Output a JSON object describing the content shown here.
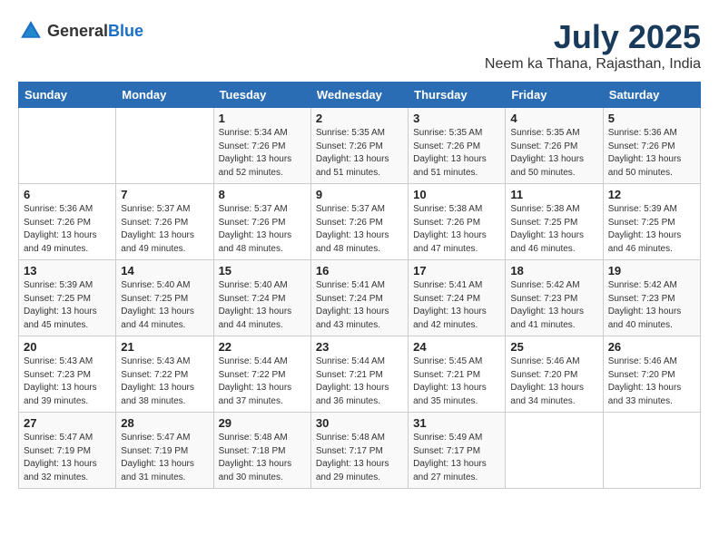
{
  "header": {
    "logo_general": "General",
    "logo_blue": "Blue",
    "title": "July 2025",
    "location": "Neem ka Thana, Rajasthan, India"
  },
  "weekdays": [
    "Sunday",
    "Monday",
    "Tuesday",
    "Wednesday",
    "Thursday",
    "Friday",
    "Saturday"
  ],
  "weeks": [
    [
      {
        "day": "",
        "detail": ""
      },
      {
        "day": "",
        "detail": ""
      },
      {
        "day": "1",
        "detail": "Sunrise: 5:34 AM\nSunset: 7:26 PM\nDaylight: 13 hours and 52 minutes."
      },
      {
        "day": "2",
        "detail": "Sunrise: 5:35 AM\nSunset: 7:26 PM\nDaylight: 13 hours and 51 minutes."
      },
      {
        "day": "3",
        "detail": "Sunrise: 5:35 AM\nSunset: 7:26 PM\nDaylight: 13 hours and 51 minutes."
      },
      {
        "day": "4",
        "detail": "Sunrise: 5:35 AM\nSunset: 7:26 PM\nDaylight: 13 hours and 50 minutes."
      },
      {
        "day": "5",
        "detail": "Sunrise: 5:36 AM\nSunset: 7:26 PM\nDaylight: 13 hours and 50 minutes."
      }
    ],
    [
      {
        "day": "6",
        "detail": "Sunrise: 5:36 AM\nSunset: 7:26 PM\nDaylight: 13 hours and 49 minutes."
      },
      {
        "day": "7",
        "detail": "Sunrise: 5:37 AM\nSunset: 7:26 PM\nDaylight: 13 hours and 49 minutes."
      },
      {
        "day": "8",
        "detail": "Sunrise: 5:37 AM\nSunset: 7:26 PM\nDaylight: 13 hours and 48 minutes."
      },
      {
        "day": "9",
        "detail": "Sunrise: 5:37 AM\nSunset: 7:26 PM\nDaylight: 13 hours and 48 minutes."
      },
      {
        "day": "10",
        "detail": "Sunrise: 5:38 AM\nSunset: 7:26 PM\nDaylight: 13 hours and 47 minutes."
      },
      {
        "day": "11",
        "detail": "Sunrise: 5:38 AM\nSunset: 7:25 PM\nDaylight: 13 hours and 46 minutes."
      },
      {
        "day": "12",
        "detail": "Sunrise: 5:39 AM\nSunset: 7:25 PM\nDaylight: 13 hours and 46 minutes."
      }
    ],
    [
      {
        "day": "13",
        "detail": "Sunrise: 5:39 AM\nSunset: 7:25 PM\nDaylight: 13 hours and 45 minutes."
      },
      {
        "day": "14",
        "detail": "Sunrise: 5:40 AM\nSunset: 7:25 PM\nDaylight: 13 hours and 44 minutes."
      },
      {
        "day": "15",
        "detail": "Sunrise: 5:40 AM\nSunset: 7:24 PM\nDaylight: 13 hours and 44 minutes."
      },
      {
        "day": "16",
        "detail": "Sunrise: 5:41 AM\nSunset: 7:24 PM\nDaylight: 13 hours and 43 minutes."
      },
      {
        "day": "17",
        "detail": "Sunrise: 5:41 AM\nSunset: 7:24 PM\nDaylight: 13 hours and 42 minutes."
      },
      {
        "day": "18",
        "detail": "Sunrise: 5:42 AM\nSunset: 7:23 PM\nDaylight: 13 hours and 41 minutes."
      },
      {
        "day": "19",
        "detail": "Sunrise: 5:42 AM\nSunset: 7:23 PM\nDaylight: 13 hours and 40 minutes."
      }
    ],
    [
      {
        "day": "20",
        "detail": "Sunrise: 5:43 AM\nSunset: 7:23 PM\nDaylight: 13 hours and 39 minutes."
      },
      {
        "day": "21",
        "detail": "Sunrise: 5:43 AM\nSunset: 7:22 PM\nDaylight: 13 hours and 38 minutes."
      },
      {
        "day": "22",
        "detail": "Sunrise: 5:44 AM\nSunset: 7:22 PM\nDaylight: 13 hours and 37 minutes."
      },
      {
        "day": "23",
        "detail": "Sunrise: 5:44 AM\nSunset: 7:21 PM\nDaylight: 13 hours and 36 minutes."
      },
      {
        "day": "24",
        "detail": "Sunrise: 5:45 AM\nSunset: 7:21 PM\nDaylight: 13 hours and 35 minutes."
      },
      {
        "day": "25",
        "detail": "Sunrise: 5:46 AM\nSunset: 7:20 PM\nDaylight: 13 hours and 34 minutes."
      },
      {
        "day": "26",
        "detail": "Sunrise: 5:46 AM\nSunset: 7:20 PM\nDaylight: 13 hours and 33 minutes."
      }
    ],
    [
      {
        "day": "27",
        "detail": "Sunrise: 5:47 AM\nSunset: 7:19 PM\nDaylight: 13 hours and 32 minutes."
      },
      {
        "day": "28",
        "detail": "Sunrise: 5:47 AM\nSunset: 7:19 PM\nDaylight: 13 hours and 31 minutes."
      },
      {
        "day": "29",
        "detail": "Sunrise: 5:48 AM\nSunset: 7:18 PM\nDaylight: 13 hours and 30 minutes."
      },
      {
        "day": "30",
        "detail": "Sunrise: 5:48 AM\nSunset: 7:17 PM\nDaylight: 13 hours and 29 minutes."
      },
      {
        "day": "31",
        "detail": "Sunrise: 5:49 AM\nSunset: 7:17 PM\nDaylight: 13 hours and 27 minutes."
      },
      {
        "day": "",
        "detail": ""
      },
      {
        "day": "",
        "detail": ""
      }
    ]
  ]
}
